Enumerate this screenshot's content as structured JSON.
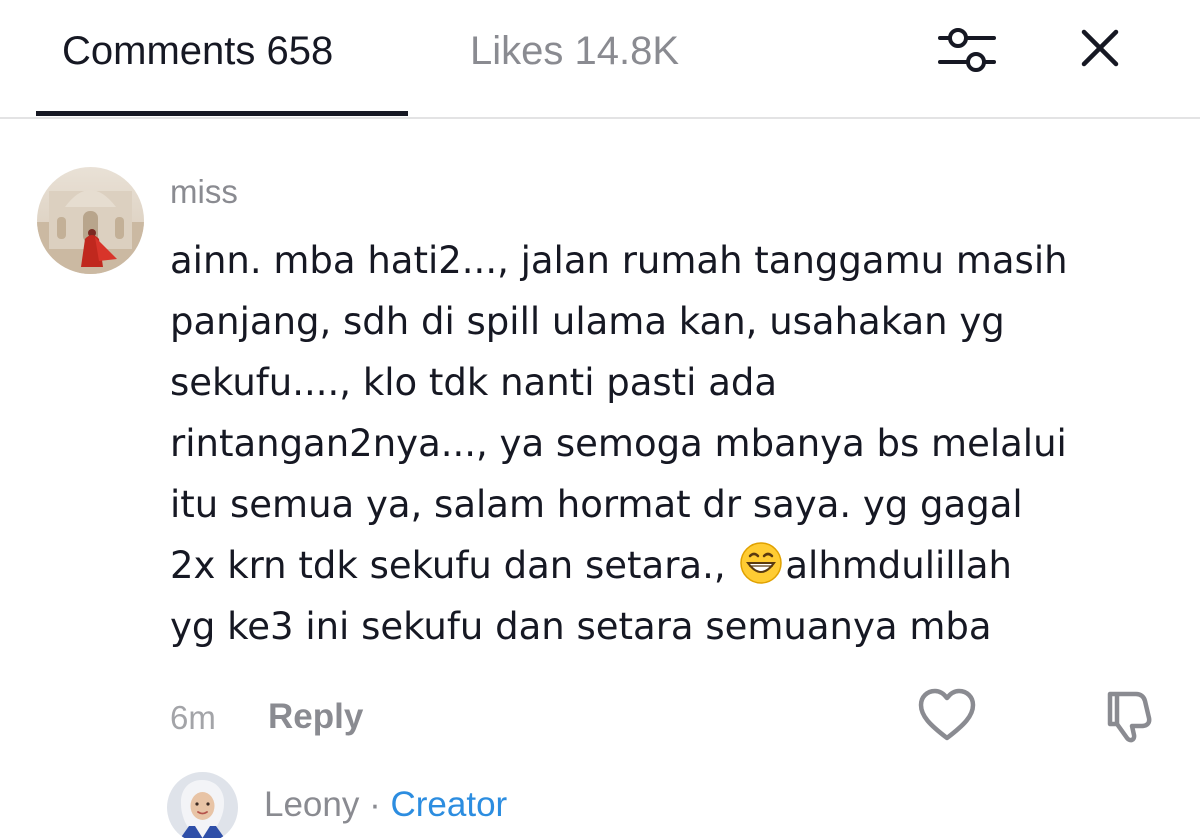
{
  "header": {
    "tabs": [
      {
        "label": "Comments 658",
        "active": true
      },
      {
        "label": "Likes 14.8K",
        "active": false
      }
    ],
    "filter_icon": "filter-sliders-icon",
    "close_icon": "close-icon"
  },
  "comment": {
    "username": "miss",
    "avatar": "user-avatar",
    "lines": [
      "ainn. mba hati2..., jalan rumah tanggamu masih",
      "panjang, sdh di spill ulama kan, usahakan yg",
      "sekufu...., klo tdk nanti pasti ada",
      "rintangan2nya..., ya semoga mbanya bs melalui",
      "itu semua ya, salam hormat dr saya. yg gagal"
    ],
    "line6_before_emoji": "2x krn tdk sekufu dan setara., ",
    "emoji": "grinning-face-emoji",
    "line6_after_emoji": "alhmdulillah",
    "line7": "yg ke3 ini sekufu dan setara semuanya mba",
    "time": "6m",
    "reply_label": "Reply",
    "like_icon": "heart-outline-icon",
    "dislike_icon": "thumbs-down-icon"
  },
  "reply_preview": {
    "name": "Leony",
    "separator": "·",
    "badge": "Creator",
    "avatar": "creator-avatar"
  },
  "colors": {
    "text_primary": "#161823",
    "text_secondary": "#8a8b91",
    "creator_badge": "#2c8de0",
    "divider": "#e3e3e4"
  }
}
